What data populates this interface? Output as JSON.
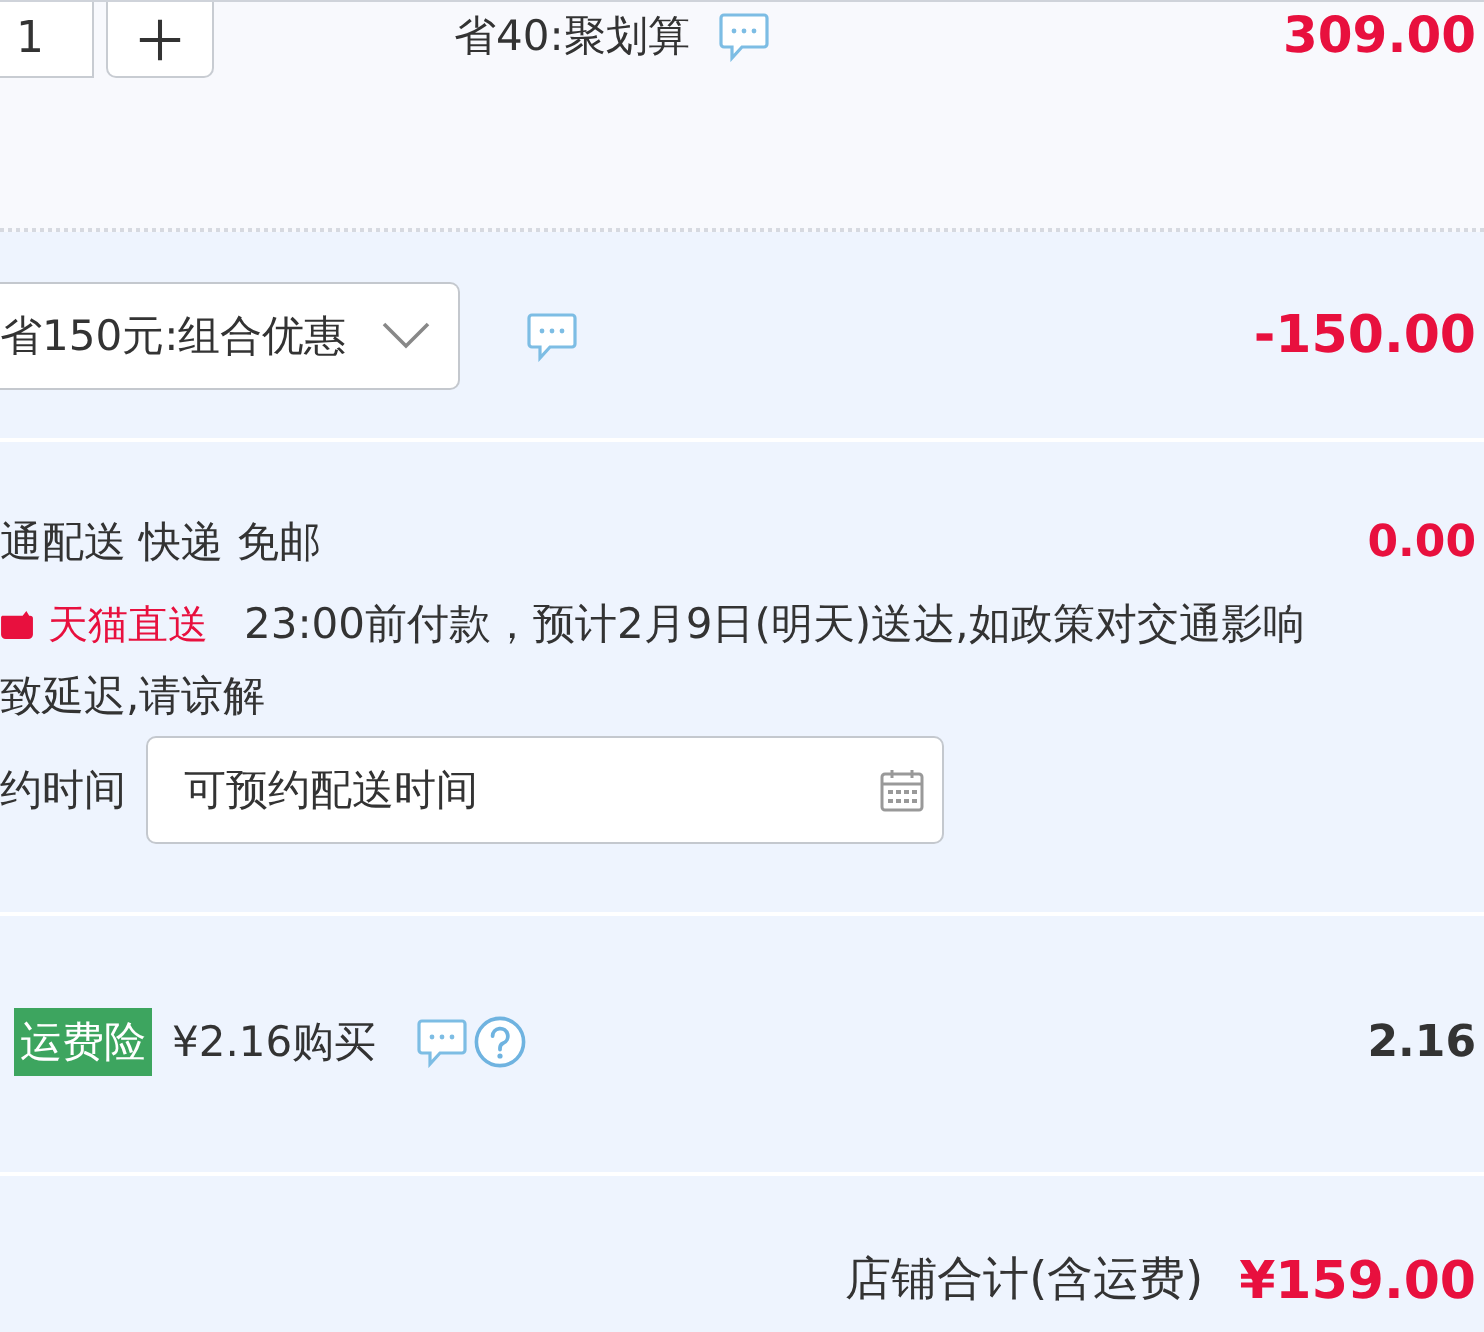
{
  "item_row": {
    "quantity_field": {
      "value": "1"
    },
    "promotion": "省40:聚划算",
    "price": "309.00"
  },
  "discount": {
    "selected_option": "省150元:组合优惠",
    "amount": "-150.00"
  },
  "shipping": {
    "method": "通配送 快递 免邮",
    "fee": "0.00",
    "badge": "天猫直送",
    "notice_lines": [
      "23:00前付款，预计2月9日(明天)送达,如政策对交通影响",
      "致延迟,请谅解"
    ],
    "appointment_label": "约时间",
    "appointment_field": {
      "placeholder": "可预约配送时间"
    }
  },
  "insurance": {
    "tag": "运费险",
    "offer": "¥2.16购买",
    "amount": "2.16"
  },
  "total": {
    "label": "店铺合计(含运费)",
    "amount": "¥159.00"
  }
}
